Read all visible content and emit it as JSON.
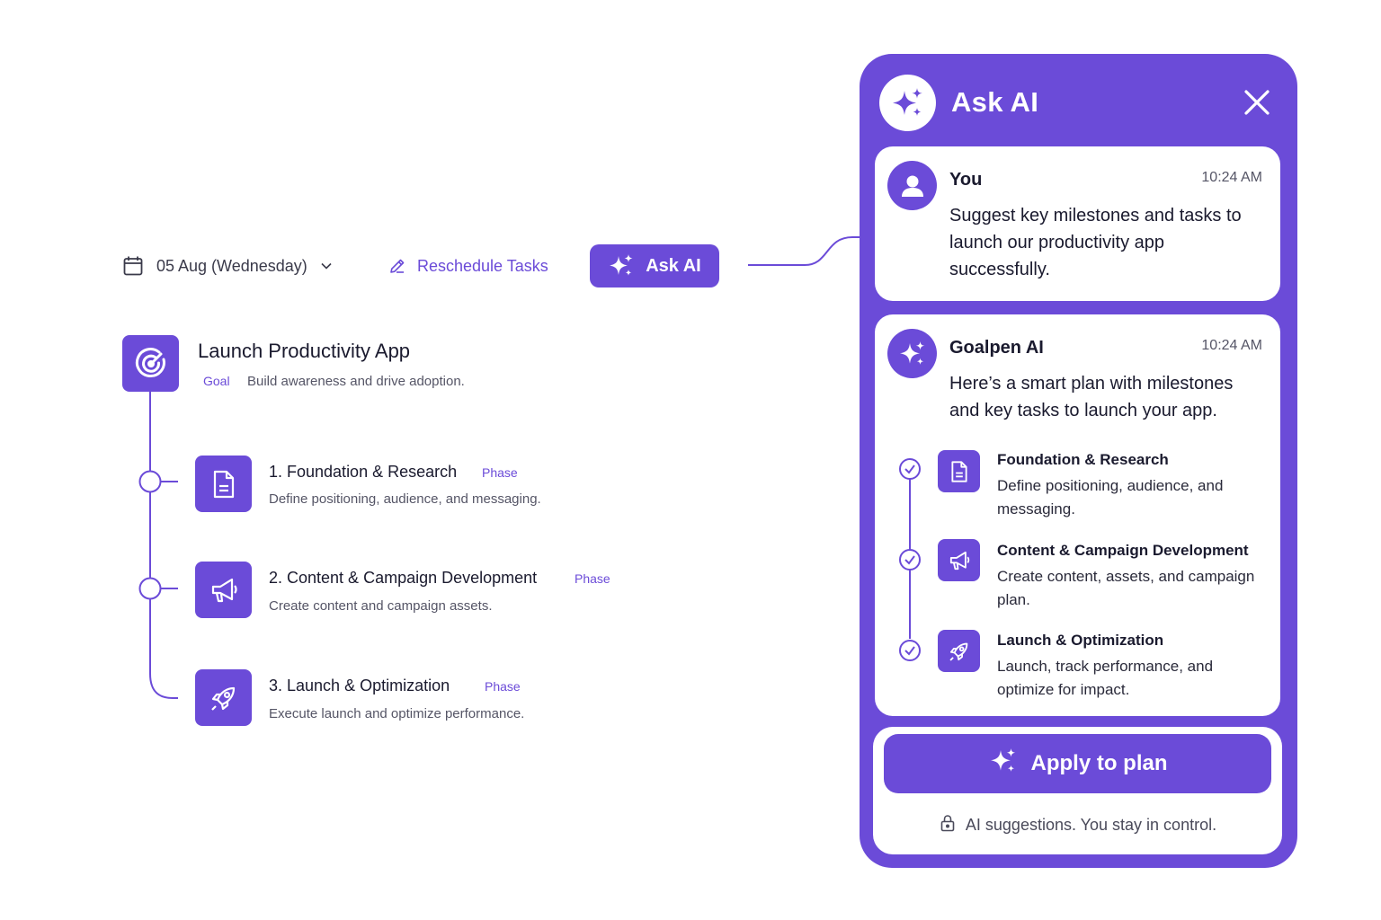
{
  "toolbar": {
    "date_label": "05 Aug (Wednesday)",
    "reschedule_label": "Reschedule Tasks",
    "ask_ai_label": "Ask AI"
  },
  "goal": {
    "title": "Launch Productivity App",
    "tag": "Goal",
    "description": "Build awareness and drive adoption."
  },
  "phases": [
    {
      "title": "1. Foundation & Research",
      "tag": "Phase",
      "description": "Define positioning, audience, and messaging.",
      "icon": "document-icon"
    },
    {
      "title": "2. Content & Campaign Development",
      "tag": "Phase",
      "description": "Create content and campaign assets.",
      "icon": "megaphone-icon"
    },
    {
      "title": "3. Launch & Optimization",
      "tag": "Phase",
      "description": "Execute launch and optimize performance.",
      "icon": "rocket-icon"
    }
  ],
  "panel": {
    "title": "Ask AI",
    "user_message": {
      "name": "You",
      "time": "10:24 AM",
      "text": "Suggest key milestones and tasks to launch our productivity app successfully."
    },
    "ai_message": {
      "name": "Goalpen AI",
      "time": "10:24 AM",
      "text": "Here’s a smart plan with milestones and key tasks to launch your app.",
      "steps": [
        {
          "title": "Foundation & Research",
          "description": "Define positioning, audience, and messaging."
        },
        {
          "title": "Content & Campaign Development",
          "description": "Create content, assets, and campaign plan."
        },
        {
          "title": "Launch & Optimization",
          "description": "Launch, track performance, and optimize for impact."
        }
      ]
    },
    "apply_label": "Apply to plan",
    "footer_note": "AI suggestions. You stay in control."
  },
  "colors": {
    "accent": "#6b4bd8",
    "text": "#1a1a2e",
    "muted": "#555566",
    "background": "#ffffff"
  }
}
